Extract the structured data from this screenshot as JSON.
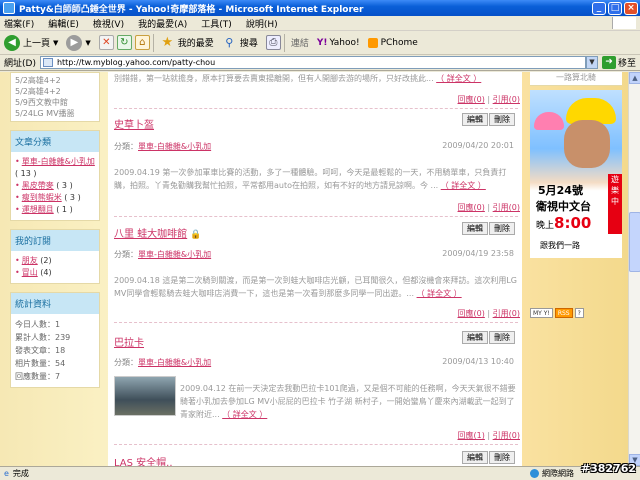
{
  "window": {
    "title": "Patty&白師師凸錘全世界 - Yahoo!奇摩部落格 - Microsoft Internet Explorer"
  },
  "menu": [
    "檔案(F)",
    "編輯(E)",
    "檢視(V)",
    "我的最愛(A)",
    "工具(T)",
    "說明(H)"
  ],
  "toolbar": {
    "back": "上一頁",
    "favorites": "我的最愛",
    "search": "搜尋",
    "connect": "連結",
    "yahoo": "Yahoo!",
    "pchome": "PChome"
  },
  "address": {
    "label": "網址(D)",
    "url": "http://tw.myblog.yahoo.com/patty-chou",
    "go": "移至"
  },
  "left": {
    "top_links": [
      "5/2高雄4+2",
      "5/2高雄4+2",
      "5/9西文教中館",
      "5/24LG MV播噐"
    ],
    "categories": {
      "title": "文章分類",
      "items": [
        {
          "label": "單車-白雜雜&小乳加",
          "count": "( 13 )"
        },
        {
          "label": "黑皮帶麥",
          "count": "( 3 )"
        },
        {
          "label": "瘦到熊蝦米",
          "count": "( 3 )"
        },
        {
          "label": "運想翻且",
          "count": "( 1 )"
        }
      ]
    },
    "subscriptions": {
      "title": "我的訂閱",
      "items": [
        {
          "label": "朋友",
          "count": "(2)"
        },
        {
          "label": "冒山",
          "count": "(4)"
        }
      ]
    },
    "stats": {
      "title": "統計資料",
      "items": [
        "今日人數：1",
        "累計人數：239",
        "發表文章：18",
        "相片數量：54",
        "回應數量：7"
      ]
    }
  },
  "main": {
    "first_excerpt": "別錯錯，第一站就擔身，原本打算要去賣東揚離開，但有人開腳去游的場所，只好改挑此...",
    "first_more": "（ 詳全文 ）",
    "posts": [
      {
        "title": "史草卜盔",
        "locked": false,
        "category_label": "分類：",
        "category": "單車-白雜雜&小乳加",
        "date": "2009/04/20 20:01",
        "excerpt": "2009.04.19 第一次參加軍車比賽的活動，多了一種體驗。呵呵，今天是最輕鬆的一天，不用騎單車，只負責打購，拍照。丫青兔勸購我幫忙拍照，平常都用auto在拍照，如有不好的地方請見諒啊。今 ...",
        "more": "（ 詳全文 ）",
        "reply": "回應(0)",
        "quote": "引用(0)"
      },
      {
        "title": "八里 蛙大咖啡館",
        "locked": true,
        "category_label": "分類：",
        "category": "單車-白雜雜&小乳加",
        "date": "2009/04/19 23:58",
        "excerpt": "2009.04.18 這是第二次騎到關渡，而是第一次到蛙大咖啡店光顧，已耳聞很久，但都沒機會來拜訪。這次利用LG MV同學會輕鬆騎去蛙大咖啡店消費一下，這也是第一次看到那麼多同學一同出遊。...",
        "more": "（ 詳全文 ）",
        "reply": "回應(0)",
        "quote": "引用(0)"
      },
      {
        "title": "巴拉卡",
        "locked": false,
        "category_label": "分類：",
        "category": "單車-白雜雜&小乳加",
        "date": "2009/04/13 10:40",
        "excerpt": "2009.04.12 在前一天決定去我動巴拉卡101爬過，又是個不可能的任務啊，今天天氣很不錯要騎著小乳加去參加LG MV小屁屁的巴拉卡 竹子湖 新村子，一開始蠻鳥丫慶來內湖載武一起到了青家附近...",
        "more": "（ 詳全文 ）",
        "reply": "回應(1)",
        "quote": "引用(0)"
      },
      {
        "title": "LAS 安全帽..",
        "locked": false
      }
    ],
    "edit_label": "編輯",
    "delete_label": "刪除"
  },
  "right": {
    "head": "一路算北騎",
    "ad": {
      "date": "5月24號",
      "channel": "衛視中文台",
      "time_prefix": "晚上",
      "time": "8:00",
      "cta": "跟我們一路",
      "side": "遊樂中"
    },
    "badges": [
      "MY Y!",
      "RSS",
      "?"
    ]
  },
  "status": {
    "left": "完成",
    "zone": "網際網路",
    "watermark": "#382762"
  },
  "colors": {
    "accent": "#cc3366",
    "title_bar": "#0a5fd8",
    "section_head": "#c7e6f5"
  }
}
